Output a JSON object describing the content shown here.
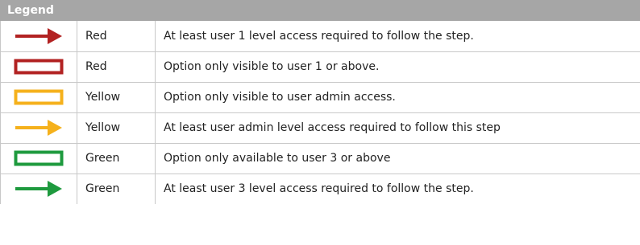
{
  "legend": {
    "title": "Legend",
    "rows": [
      {
        "symbol": "arrow",
        "symbol_name": "red-arrow-icon",
        "stroke": "#b22222",
        "color_label": "Red",
        "description": "At least user 1 level access required to follow the step."
      },
      {
        "symbol": "box",
        "symbol_name": "red-box-icon",
        "stroke": "#b22222",
        "color_label": "Red",
        "description": "Option only visible to user 1 or above."
      },
      {
        "symbol": "box",
        "symbol_name": "yellow-box-icon",
        "stroke": "#f5b11c",
        "color_label": "Yellow",
        "description": "Option only visible to user admin access."
      },
      {
        "symbol": "arrow",
        "symbol_name": "yellow-arrow-icon",
        "stroke": "#f5b11c",
        "color_label": "Yellow",
        "description": "At least user admin level access required to follow this step"
      },
      {
        "symbol": "box",
        "symbol_name": "green-box-icon",
        "stroke": "#1e9a3e",
        "color_label": "Green",
        "description": "Option only available to user 3 or above"
      },
      {
        "symbol": "arrow",
        "symbol_name": "green-arrow-icon",
        "stroke": "#1e9a3e",
        "color_label": "Green",
        "description": "At least user 3 level access required to follow the step."
      }
    ]
  }
}
